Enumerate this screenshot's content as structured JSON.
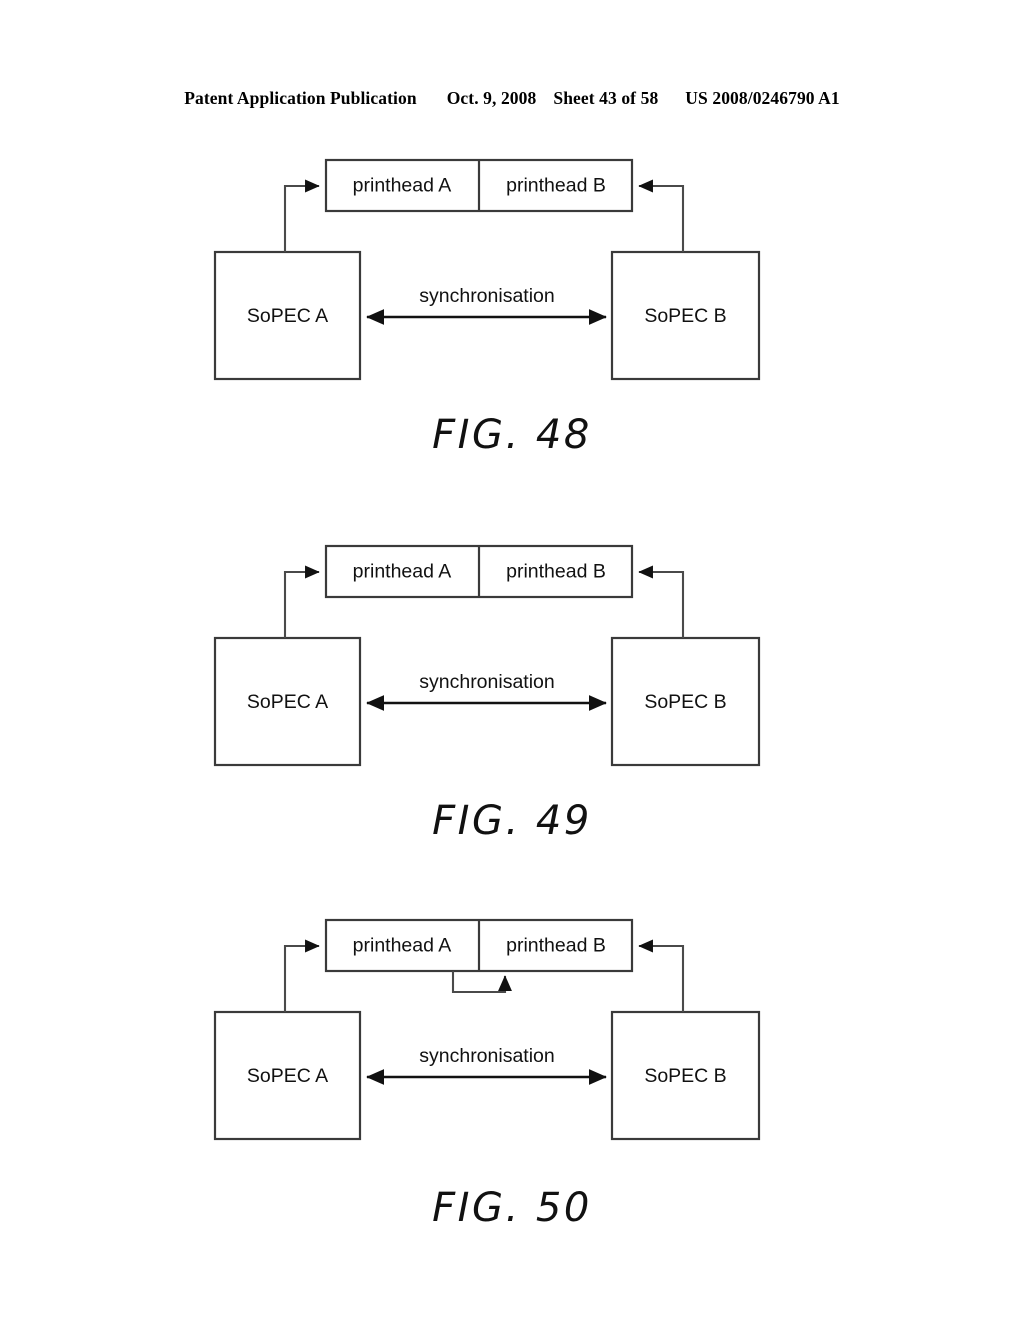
{
  "header": {
    "publication": "Patent Application Publication",
    "date": "Oct. 9, 2008",
    "sheet": "Sheet 43 of 58",
    "patent_number": "US 2008/0246790 A1"
  },
  "colors": {
    "ink": "#111111",
    "line": "#4a4a4a",
    "box_stroke": "#3a3a3a",
    "page_background": "#ffffff"
  },
  "figures": [
    {
      "id": "fig-48",
      "caption": "FIG. 48",
      "blocks": {
        "printhead_a": "printhead A",
        "printhead_b": "printhead B",
        "sopec_a": "SoPEC A",
        "sopec_b": "SoPEC B"
      },
      "connections": {
        "sync": "synchronisation",
        "sopec_a_to_printhead_a": "",
        "sopec_b_to_printhead_b": ""
      },
      "has_printhead_loopback": false
    },
    {
      "id": "fig-49",
      "caption": "FIG. 49",
      "blocks": {
        "printhead_a": "printhead A",
        "printhead_b": "printhead B",
        "sopec_a": "SoPEC A",
        "sopec_b": "SoPEC B"
      },
      "connections": {
        "sync": "synchronisation",
        "sopec_a_to_printhead_a": "",
        "sopec_b_to_printhead_b": ""
      },
      "has_printhead_loopback": false
    },
    {
      "id": "fig-50",
      "caption": "FIG. 50",
      "blocks": {
        "printhead_a": "printhead A",
        "printhead_b": "printhead B",
        "sopec_a": "SoPEC A",
        "sopec_b": "SoPEC B"
      },
      "connections": {
        "sync": "synchronisation",
        "sopec_a_to_printhead_a": "",
        "sopec_b_to_printhead_b": "",
        "printhead_a_to_printhead_b": ""
      },
      "has_printhead_loopback": true
    }
  ]
}
